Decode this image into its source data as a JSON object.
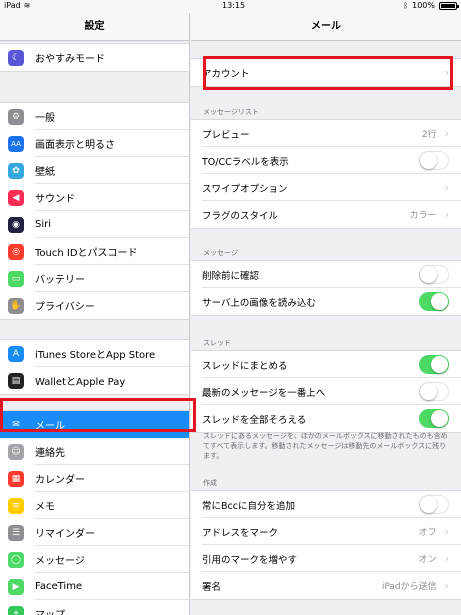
{
  "status_bar": {
    "device": "iPad",
    "time": "13:15",
    "battery": "100%"
  },
  "sidebar": {
    "title": "設定",
    "groups": [
      {
        "items": [
          {
            "label": "おやすみモード",
            "icon": "moon-icon",
            "color": "#5856d6",
            "glyph": "☾"
          }
        ]
      },
      {
        "items": [
          {
            "label": "一般",
            "icon": "gear-icon",
            "color": "#8e8e93",
            "glyph": "⚙"
          },
          {
            "label": "画面表示と明るさ",
            "icon": "display-brightness-icon",
            "color": "#1a73e8",
            "glyph": "AA"
          },
          {
            "label": "壁紙",
            "icon": "wallpaper-icon",
            "color": "#34aadc",
            "glyph": "✿"
          },
          {
            "label": "サウンド",
            "icon": "speaker-icon",
            "color": "#ff2d55",
            "glyph": "◀"
          },
          {
            "label": "Siri",
            "icon": "siri-icon",
            "color": "#222244",
            "glyph": "◉"
          },
          {
            "label": "Touch IDとパスコード",
            "icon": "fingerprint-icon",
            "color": "#ff3b30",
            "glyph": "◎"
          },
          {
            "label": "バッテリー",
            "icon": "battery-icon",
            "color": "#4cd964",
            "glyph": "▭"
          },
          {
            "label": "プライバシー",
            "icon": "hand-icon",
            "color": "#8e8e93",
            "glyph": "✋"
          }
        ]
      },
      {
        "items": [
          {
            "label": "iTunes StoreとApp Store",
            "icon": "app-store-icon",
            "color": "#1a8cf7",
            "glyph": "A"
          },
          {
            "label": "WalletとApple Pay",
            "icon": "wallet-icon",
            "color": "#222222",
            "glyph": "▤"
          }
        ]
      },
      {
        "items": [
          {
            "label": "メール",
            "icon": "mail-icon",
            "color": "#1a8cf7",
            "glyph": "✉"
          },
          {
            "label": "連絡先",
            "icon": "contacts-icon",
            "color": "#a2a2a7",
            "glyph": "☺"
          },
          {
            "label": "カレンダー",
            "icon": "calendar-icon",
            "color": "#ff3b30",
            "glyph": "▦"
          },
          {
            "label": "メモ",
            "icon": "notes-icon",
            "color": "#ffcc00",
            "glyph": "≡"
          },
          {
            "label": "リマインダー",
            "icon": "reminders-icon",
            "color": "#8e8e93",
            "glyph": "☰"
          },
          {
            "label": "メッセージ",
            "icon": "messages-icon",
            "color": "#4cd964",
            "glyph": "◯"
          },
          {
            "label": "FaceTime",
            "icon": "facetime-icon",
            "color": "#4cd964",
            "glyph": "▶"
          },
          {
            "label": "マップ",
            "icon": "maps-icon",
            "color": "#34c759",
            "glyph": "⌖"
          }
        ]
      }
    ],
    "selected": "メール"
  },
  "main": {
    "title": "メール",
    "account_label": "アカウント",
    "sections": [
      {
        "title": "メッセージリスト",
        "rows": [
          {
            "label": "プレビュー",
            "value": "2行",
            "kind": "chevron"
          },
          {
            "label": "TO/CCラベルを表示",
            "kind": "toggle",
            "on": false
          },
          {
            "label": "スワイプオプション",
            "kind": "chevron"
          },
          {
            "label": "フラグのスタイル",
            "value": "カラー",
            "kind": "chevron"
          }
        ]
      },
      {
        "title": "メッセージ",
        "rows": [
          {
            "label": "削除前に確認",
            "kind": "toggle",
            "on": false
          },
          {
            "label": "サーバ上の画像を読み込む",
            "kind": "toggle",
            "on": true
          }
        ]
      },
      {
        "title": "スレッド",
        "rows": [
          {
            "label": "スレッドにまとめる",
            "kind": "toggle",
            "on": true
          },
          {
            "label": "最新のメッセージを一番上へ",
            "kind": "toggle",
            "on": false
          },
          {
            "label": "スレッドを全部そろえる",
            "kind": "toggle",
            "on": true
          }
        ],
        "footer": "スレッドにあるメッセージを、ほかのメールボックスに移動されたものも含めてすべて表示します。移動されたメッセージは移動先のメールボックスに残ります。"
      },
      {
        "title": "作成",
        "rows": [
          {
            "label": "常にBccに自分を追加",
            "kind": "toggle",
            "on": false
          },
          {
            "label": "アドレスをマーク",
            "value": "オフ",
            "kind": "chevron"
          },
          {
            "label": "引用のマークを増やす",
            "value": "オン",
            "kind": "chevron"
          },
          {
            "label": "署名",
            "value": "iPadから送信",
            "kind": "chevron"
          }
        ]
      }
    ]
  },
  "colors": {
    "highlight": "#e3161f",
    "selected": "#1a8cf7",
    "toggle_on": "#4cd964"
  }
}
